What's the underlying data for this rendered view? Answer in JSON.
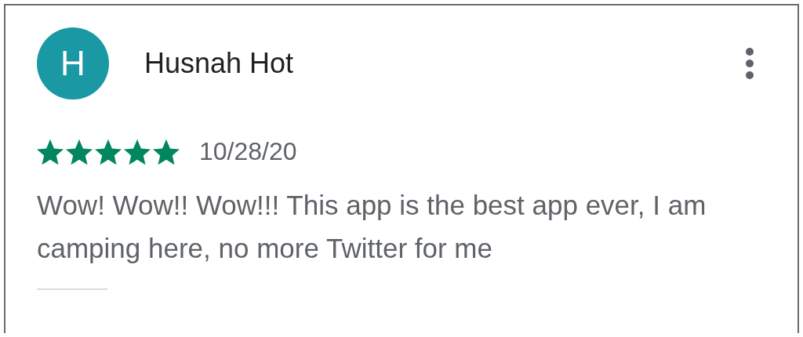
{
  "review": {
    "avatar_letter": "H",
    "author": "Husnah Hot",
    "stars": 5,
    "date": "10/28/20",
    "text": "Wow! Wow!! Wow!!! This app is the best app ever, I am camping here, no more Twitter for me"
  }
}
